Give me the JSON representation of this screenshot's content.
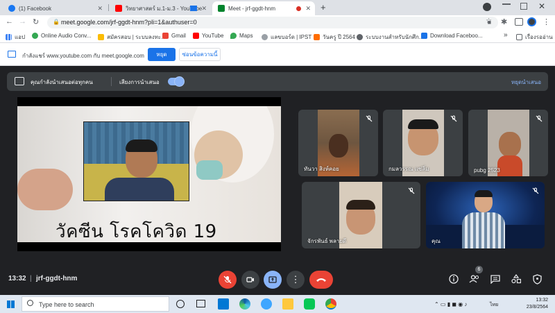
{
  "browser": {
    "tabs": [
      {
        "title": "(1) Facebook",
        "color": "#1877f2"
      },
      {
        "title": "วิทยาศาสตร์ ม.1-ม.3 - YouTube",
        "color": "#ff0000"
      },
      {
        "title": "Meet - jrf-ggdt-hnm",
        "color": "#00832d"
      }
    ],
    "url": "meet.google.com/jrf-ggdt-hnm?pli=1&authuser=0",
    "bookmarks": [
      {
        "label": "แอป",
        "color": "#5f6368"
      },
      {
        "label": "Online Audio Conv...",
        "color": "#34a853"
      },
      {
        "label": "สมัครสอบ | ระบบลงทะ...",
        "color": "#fbbc04"
      },
      {
        "label": "Gmail",
        "color": "#ea4335"
      },
      {
        "label": "YouTube",
        "color": "#ff0000"
      },
      {
        "label": "Maps",
        "color": "#34a853"
      },
      {
        "label": "แลขบอร์ด | IPST",
        "color": "#9aa0a6"
      },
      {
        "label": "วันครู ปี 2564",
        "color": "#ff6d00"
      },
      {
        "label": "ระบบงานสำหรับนักศึก...",
        "color": "#5f6368"
      },
      {
        "label": "Download Faceboo...",
        "color": "#1a73e8"
      }
    ],
    "bookmarks_more": "»",
    "reading_list": "เรื่องรออ่าน"
  },
  "sharebar": {
    "message": "กำลังแชร์ www.youtube.com กับ meet.google.com",
    "stop_label": "หยุด",
    "hide_label": "ซ่อนข้อความนี้"
  },
  "meet": {
    "presenting_text": "คุณกำลังนำเสนอต่อทุกคน",
    "audio_label": "เสียงการนำเสนอ",
    "stop_presenting": "หยุดนำเสนอ",
    "slide_title": "วัคซีน โรคโควิด 19",
    "participants": [
      {
        "name": "ทันวา สิงห์คอย"
      },
      {
        "name": "กมลวรรณ แซ่ลิ่ม"
      },
      {
        "name": "pubg 2523"
      },
      {
        "name": "จักรพันธ์ พลายดี"
      },
      {
        "name": "คุณ"
      }
    ],
    "time": "13:32",
    "separator": "|",
    "meeting_code": "jrf-ggdt-hnm",
    "people_count": "6"
  },
  "taskbar": {
    "search_placeholder": "Type here to search",
    "language": "ไทย",
    "time": "13:32",
    "date": "23/8/2564"
  }
}
